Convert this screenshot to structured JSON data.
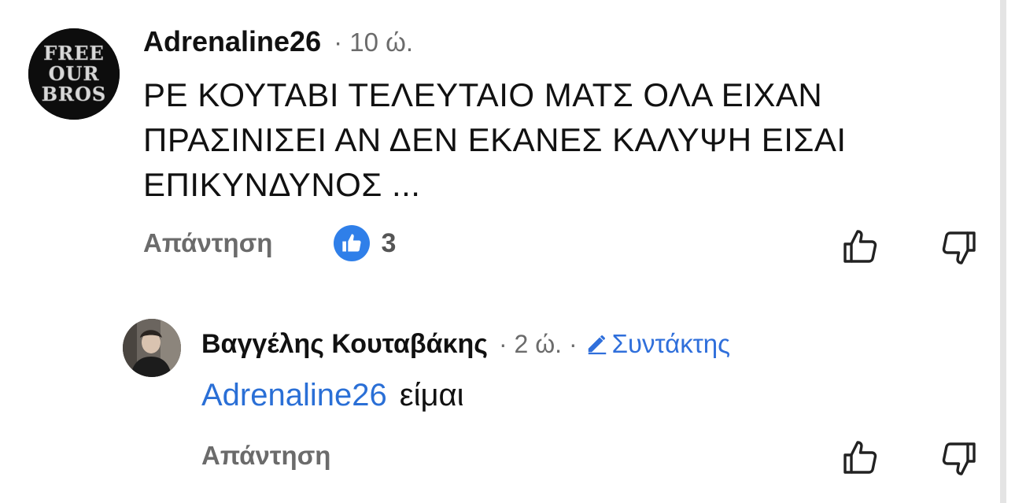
{
  "comment": {
    "author": "Adrenaline26",
    "meta": "· 10 ώ.",
    "avatar_text": [
      "FREE",
      "OUR",
      "BROS"
    ],
    "text": "ΡΕ ΚΟΥΤΑΒΙ ΤΕΛΕΥΤΑΙΟ ΜΑΤΣ ΟΛΑ ΕΙΧΑΝ ΠΡΑΣΙΝΙΣΕΙ ΑΝ ΔΕΝ ΕΚΑΝΕΣ ΚΑΛΥΨΗ ΕΙΣΑΙ ΕΠΙΚΥΝΔΥΝΟΣ ...",
    "reply_label": "Απάντηση",
    "like_count": "3",
    "like_icon": "thumbs-up-filled-icon",
    "upvote_icon": "thumbs-up-outline-icon",
    "downvote_icon": "thumbs-down-outline-icon"
  },
  "reply": {
    "author": "Βαγγέλης Κουταβάκης",
    "meta": "· 2 ώ. ·",
    "editor_badge": "Συντάκτης",
    "editor_icon": "pencil-icon",
    "mention": "Adrenaline26",
    "text": "είμαι",
    "reply_label": "Απάντηση"
  },
  "colors": {
    "accent": "#2f7fe9",
    "link": "#2a6fd6",
    "muted": "#6b6b6b"
  }
}
